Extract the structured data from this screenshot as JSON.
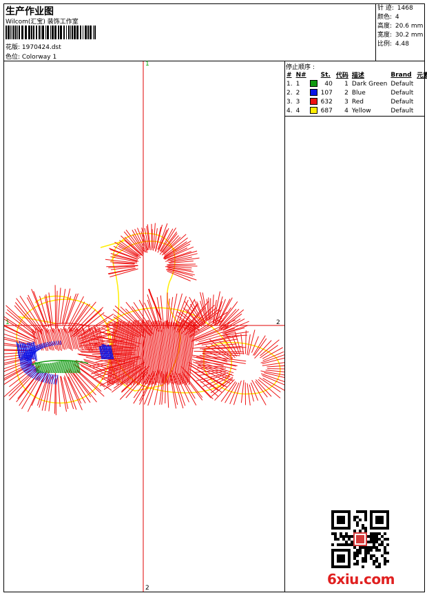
{
  "header": {
    "title": "生产作业图",
    "subtitle": "Wilcom(汇宝) 装饰工作室",
    "design": "花版: 1970424.dst",
    "colorway": "色位: Colorway 1"
  },
  "stats": [
    {
      "label": "针 迹:",
      "value": "1468"
    },
    {
      "label": "颜色:",
      "value": "4"
    },
    {
      "label": "高度:",
      "value": "20.6 mm"
    },
    {
      "label": "宽度:",
      "value": "30.2 mm"
    },
    {
      "label": "比例:",
      "value": "4.48"
    }
  ],
  "stop_sequence": {
    "title": "停止顺序 :",
    "columns": [
      "#",
      "N#",
      "St.",
      "代码",
      "描述",
      "Brand",
      "元素"
    ],
    "rows": [
      {
        "num": "1.",
        "n": "1",
        "color": "#119911",
        "st": "40",
        "code": "1",
        "desc": "Dark Green",
        "brand": "Default"
      },
      {
        "num": "2.",
        "n": "2",
        "color": "#0a14e6",
        "st": "107",
        "code": "2",
        "desc": "Blue",
        "brand": "Default"
      },
      {
        "num": "3.",
        "n": "3",
        "color": "#ee1111",
        "st": "632",
        "code": "3",
        "desc": "Red",
        "brand": "Default"
      },
      {
        "num": "4.",
        "n": "4",
        "color": "#ffee00",
        "st": "687",
        "code": "4",
        "desc": "Yellow",
        "brand": "Default"
      }
    ]
  },
  "axes": {
    "v_top": "1",
    "v_bottom": "2",
    "h_left": "1",
    "h_right": "2"
  },
  "watermark": "6xiu.com",
  "colors": {
    "axis": "#e00000",
    "dark_green": "#119911",
    "blue": "#0a14e6",
    "red": "#ee1111",
    "yellow": "#ffee00"
  }
}
